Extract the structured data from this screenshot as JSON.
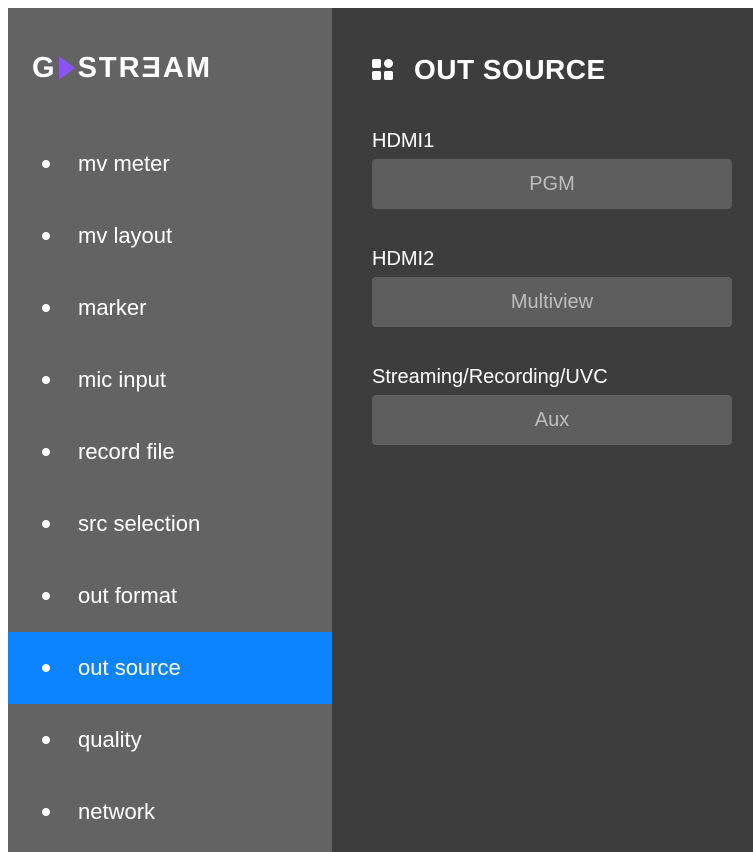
{
  "logo": {
    "text_left": "G",
    "text_right": "STRƎAM",
    "brand_color": "#8a53ff"
  },
  "sidebar": {
    "items": [
      {
        "label": "mv meter",
        "active": false
      },
      {
        "label": "mv layout",
        "active": false
      },
      {
        "label": "marker",
        "active": false
      },
      {
        "label": "mic input",
        "active": false
      },
      {
        "label": "record file",
        "active": false
      },
      {
        "label": "src selection",
        "active": false
      },
      {
        "label": "out format",
        "active": false
      },
      {
        "label": "out source",
        "active": true
      },
      {
        "label": "quality",
        "active": false
      },
      {
        "label": "network",
        "active": false
      }
    ],
    "active_color": "#0c84ff"
  },
  "panel": {
    "icon": "grid-icon",
    "title": "OUT SOURCE",
    "fields": [
      {
        "label": "HDMI1",
        "value": "PGM"
      },
      {
        "label": "HDMI2",
        "value": "Multiview"
      },
      {
        "label": "Streaming/Recording/UVC",
        "value": "Aux"
      }
    ]
  }
}
